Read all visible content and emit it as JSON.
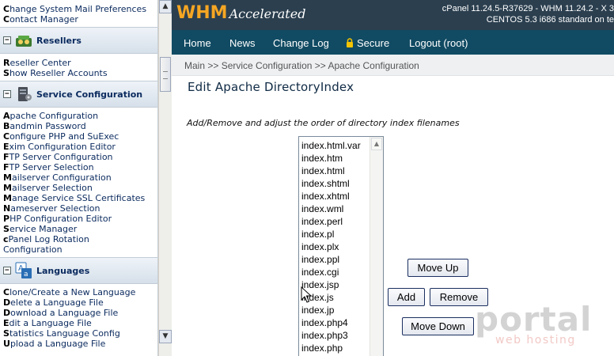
{
  "sidebar": {
    "top_links": [
      {
        "first": "C",
        "rest": "hange System Mail Preferences"
      },
      {
        "first": "C",
        "rest": "ontact Manager"
      }
    ],
    "sections": [
      {
        "title": "Resellers",
        "toggle": "−",
        "icon": "resellers-icon",
        "links": [
          {
            "first": "R",
            "rest": "eseller Center"
          },
          {
            "first": "S",
            "rest": "how Reseller Accounts"
          }
        ]
      },
      {
        "title": "Service Configuration",
        "toggle": "−",
        "icon": "server-icon",
        "links": [
          {
            "first": "A",
            "rest": "pache Configuration"
          },
          {
            "first": "B",
            "rest": "andmin Password"
          },
          {
            "first": "C",
            "rest": "onfigure PHP and SuExec"
          },
          {
            "first": "E",
            "rest": "xim Configuration Editor"
          },
          {
            "first": "F",
            "rest": "TP Server Configuration"
          },
          {
            "first": "F",
            "rest": "TP Server Selection"
          },
          {
            "first": "M",
            "rest": "ailserver Configuration"
          },
          {
            "first": "M",
            "rest": "ailserver Selection"
          },
          {
            "first": "M",
            "rest": "anage Service SSL Certificates"
          },
          {
            "first": "N",
            "rest": "ameserver Selection"
          },
          {
            "first": "P",
            "rest": "HP Configuration Editor"
          },
          {
            "first": "S",
            "rest": "ervice Manager"
          },
          {
            "first": "c",
            "rest": "Panel Log Rotation"
          },
          {
            "first": "",
            "rest": "Configuration"
          }
        ]
      },
      {
        "title": "Languages",
        "toggle": "−",
        "icon": "languages-icon",
        "links": [
          {
            "first": "C",
            "rest": "lone/Create a New Language"
          },
          {
            "first": "D",
            "rest": "elete a Language File"
          },
          {
            "first": "D",
            "rest": "ownload a Language File"
          },
          {
            "first": "E",
            "rest": "dit a Language File"
          },
          {
            "first": "S",
            "rest": "tatistics Language Config"
          },
          {
            "first": "U",
            "rest": "pload a Language File"
          }
        ]
      }
    ],
    "scroll_up": "▲",
    "scroll_down": "▼"
  },
  "header": {
    "logo_main": "WHM",
    "logo_sub": "Accelerated",
    "version_line1": "cPanel 11.24.5-R37629 - WHM 11.24.2 - X 3",
    "version_line2": "CENTOS 5.3 i686 standard on te"
  },
  "nav": {
    "items": [
      "Home",
      "News",
      "Change Log",
      "Secure",
      "Logout (root)"
    ]
  },
  "breadcrumb": "Main >> Service Configuration >> Apache Configuration",
  "main": {
    "title": "Edit Apache DirectoryIndex",
    "instructions": "Add/Remove and adjust the order of directory index filenames",
    "files": [
      "index.html.var",
      "index.htm",
      "index.html",
      "index.shtml",
      "index.xhtml",
      "index.wml",
      "index.perl",
      "index.pl",
      "index.plx",
      "index.ppl",
      "index.cgi",
      "index.jsp",
      "index.js",
      "index.jp",
      "index.php4",
      "index.php3",
      "index.php"
    ],
    "buttons": {
      "move_up": "Move Up",
      "add": "Add",
      "remove": "Remove",
      "move_down": "Move Down"
    }
  },
  "watermark": {
    "word": "portal",
    "sub": "web hosting"
  },
  "colors": {
    "header_bg": "#2b3f4f",
    "nav_bg": "#114b63",
    "logo_orange": "#f5a623",
    "link_text": "#0a2a5e"
  }
}
